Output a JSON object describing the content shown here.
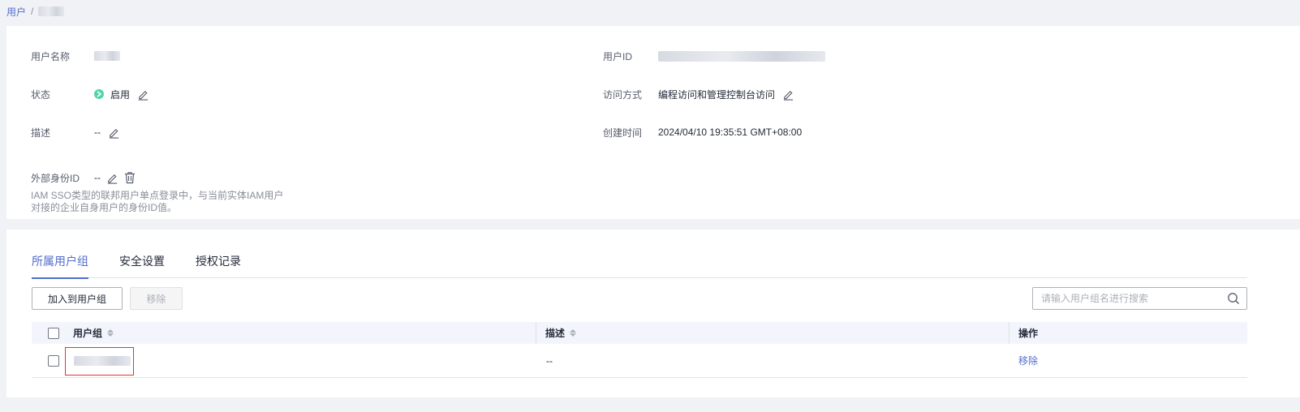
{
  "breadcrumb": {
    "root": "用户",
    "separator": "/"
  },
  "info": {
    "username_label": "用户名称",
    "status_label": "状态",
    "status_value": "启用",
    "description_label": "描述",
    "description_value": "--",
    "external_id_label": "外部身份ID",
    "external_id_value": "--",
    "external_id_hint_line1": "IAM SSO类型的联邦用户单点登录中，与当前实体IAM用户",
    "external_id_hint_line2": "对接的企业自身用户的身份ID值。",
    "user_id_label": "用户ID",
    "access_mode_label": "访问方式",
    "access_mode_value": "编程访问和管理控制台访问",
    "created_label": "创建时间",
    "created_value": "2024/04/10 19:35:51 GMT+08:00",
    "status_color": "#50d4ab"
  },
  "tabs": [
    {
      "label": "所属用户组",
      "active": true
    },
    {
      "label": "安全设置",
      "active": false
    },
    {
      "label": "授权记录",
      "active": false
    }
  ],
  "toolbar": {
    "add_label": "加入到用户组",
    "remove_label": "移除",
    "search_placeholder": "请输入用户组名进行搜索"
  },
  "table": {
    "columns": [
      "用户组",
      "描述",
      "操作"
    ],
    "rows": [
      {
        "description": "--",
        "action": "移除"
      }
    ]
  },
  "colors": {
    "accent": "#526ecc",
    "highlight": "#e8342c"
  }
}
